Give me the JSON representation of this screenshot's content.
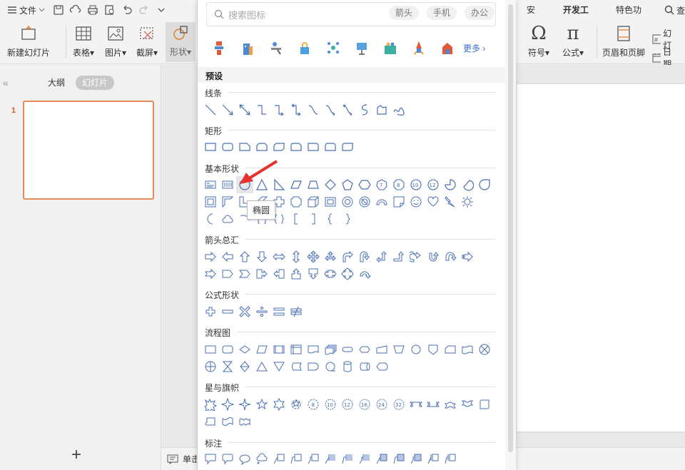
{
  "menu": {
    "file_label": "文件"
  },
  "ribbon_tabs": [
    {
      "label": "安全"
    },
    {
      "label": "开发工具"
    },
    {
      "label": "特色功能"
    },
    {
      "label": "查"
    }
  ],
  "toolbar": {
    "new_slide": "新建幻灯片",
    "table": "表格",
    "picture": "图片",
    "screenshot": "截屏",
    "shape": "形状",
    "symbol": "符号",
    "formula": "公式",
    "header_footer": "页眉和页脚",
    "slide_no": "幻灯",
    "date": "日期"
  },
  "left_panel": {
    "outline_tab": "大纲",
    "slides_tab": "幻灯片",
    "slide_number": "1"
  },
  "status": {
    "notes_label": "单击"
  },
  "shapes_dropdown": {
    "search_placeholder": "搜索图标",
    "chips": [
      "箭头",
      "手机",
      "办公"
    ],
    "more_label": "更多",
    "preset_label": "预设",
    "sections": {
      "lines": "线条",
      "rect": "矩形",
      "basic": "基本形状",
      "arrows": "箭头总汇",
      "formula": "公式形状",
      "flowchart": "流程图",
      "stars": "星与旗帜",
      "callouts": "标注"
    },
    "tooltip": "椭圆"
  },
  "colors": {
    "accent": "#4a6fb0",
    "arrow": "#e5322d",
    "slide_border": "#e88a5a"
  }
}
